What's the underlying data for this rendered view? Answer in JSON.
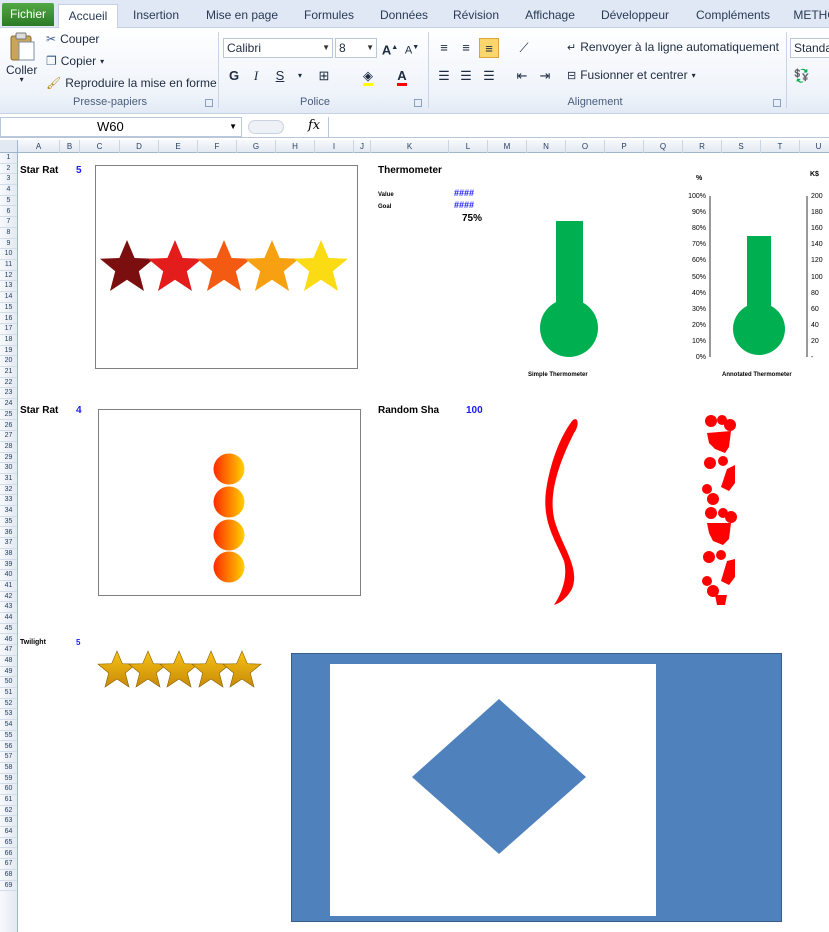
{
  "tabs": [
    "Fichier",
    "Accueil",
    "Insertion",
    "Mise en page",
    "Formules",
    "Données",
    "Révision",
    "Affichage",
    "Développeur",
    "Compléments",
    "METHO"
  ],
  "clipboard": {
    "paste": "Coller",
    "cut": "Couper",
    "copy": "Copier",
    "format_painter": "Reproduire la mise en forme",
    "group": "Presse-papiers"
  },
  "font": {
    "name": "Calibri",
    "size": "8",
    "bold": "G",
    "italic": "I",
    "underline": "S",
    "group": "Police"
  },
  "alignment": {
    "wrap": "Renvoyer à la ligne automatiquement",
    "merge": "Fusionner et centrer",
    "group": "Alignement"
  },
  "number": {
    "format": "Standa"
  },
  "formula_bar": {
    "name_box": "W60",
    "fx": "fx",
    "value": ""
  },
  "columns": [
    "A",
    "B",
    "C",
    "D",
    "E",
    "F",
    "G",
    "H",
    "I",
    "J",
    "K",
    "L",
    "M",
    "N",
    "O",
    "P",
    "Q",
    "R",
    "S",
    "T",
    "U"
  ],
  "rows": [
    "1",
    "2",
    "3",
    "4",
    "5",
    "6",
    "7",
    "8",
    "9",
    "10",
    "11",
    "12",
    "13",
    "14",
    "15",
    "16",
    "17",
    "18",
    "19",
    "20",
    "21",
    "22",
    "23",
    "24",
    "25",
    "26",
    "27",
    "28",
    "29",
    "30",
    "31",
    "32",
    "33",
    "34",
    "35",
    "36",
    "37",
    "38",
    "39",
    "40",
    "41",
    "42",
    "43",
    "44",
    "45",
    "46",
    "47",
    "48",
    "49",
    "50",
    "51",
    "52",
    "53",
    "54",
    "55",
    "56",
    "57",
    "58",
    "59",
    "60",
    "61",
    "62",
    "63",
    "64",
    "65",
    "66",
    "67",
    "68",
    "69"
  ],
  "sheet": {
    "star_rating_1": {
      "label": "Star Rat",
      "value": "5"
    },
    "thermometer": {
      "label": "Thermometer",
      "value_label": "Value",
      "value": "####",
      "goal_label": "Goal",
      "goal": "####",
      "pct": "75%"
    },
    "simple_thermo_caption": "Simple Thermometer",
    "annotated_thermo_caption": "Annotated Thermometer",
    "pct_axis_title": "%",
    "pct_ticks": [
      "100%",
      "90%",
      "80%",
      "70%",
      "60%",
      "50%",
      "40%",
      "30%",
      "20%",
      "10%",
      "0%"
    ],
    "k_axis_title": "K$",
    "k_ticks": [
      "200",
      "180",
      "160",
      "140",
      "120",
      "100",
      "80",
      "60",
      "40",
      "20",
      "-"
    ],
    "star_rating_2": {
      "label": "Star Rat",
      "value": "4"
    },
    "random_shape": {
      "label": "Random Sha",
      "value": "100"
    },
    "twilight": {
      "label": "Twilight",
      "value": "5"
    }
  },
  "colors": {
    "thermo": "#00b050",
    "shape_red": "#ff0000",
    "diamond": "#4f81bd",
    "number_blue": "#1a1aff"
  }
}
